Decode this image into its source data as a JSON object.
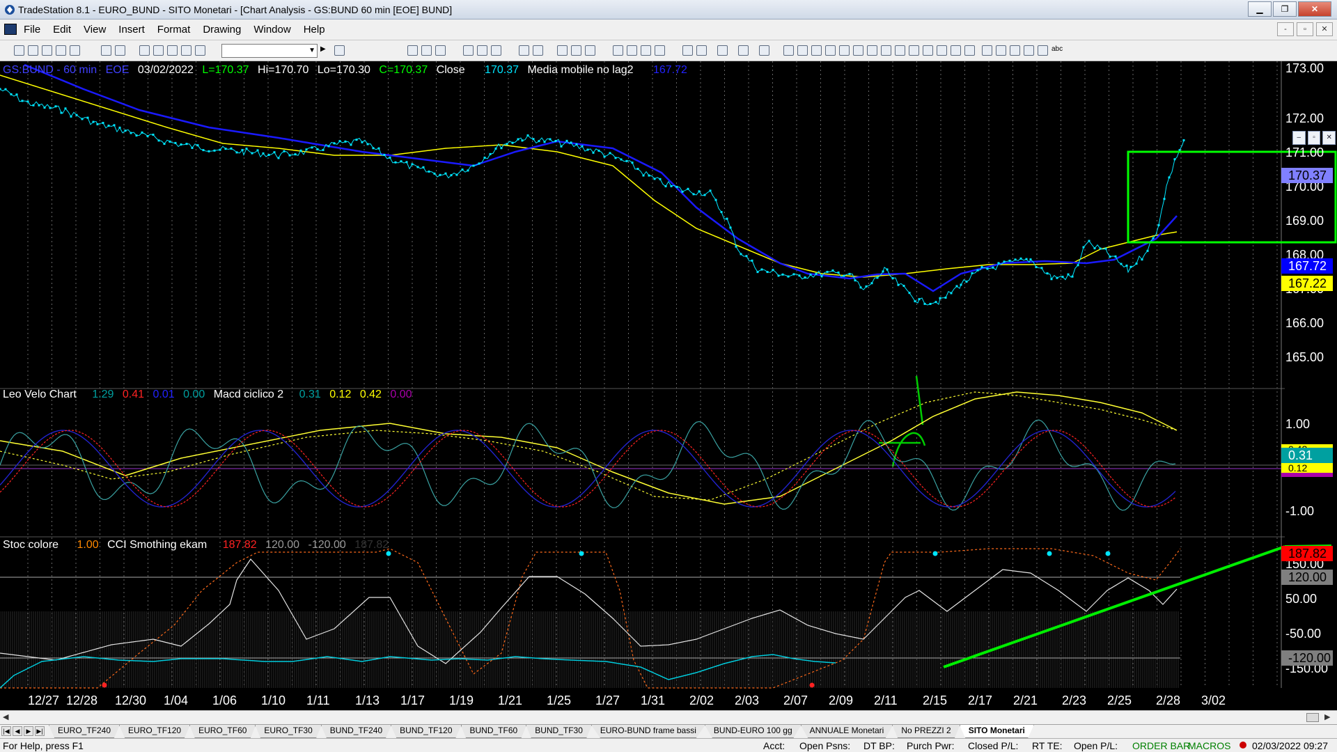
{
  "window": {
    "title": "TradeStation 8.1 - EURO_BUND - SITO Monetari - [Chart Analysis - GS:BUND  60 min  [EOE] BUND]",
    "buttons": [
      "▁",
      "❐",
      "✕"
    ]
  },
  "menubar": {
    "items": [
      "File",
      "Edit",
      "View",
      "Insert",
      "Format",
      "Drawing",
      "Window",
      "Help"
    ],
    "mdi_buttons": [
      "-",
      "▫",
      "✕"
    ]
  },
  "price_pane": {
    "header": {
      "symbol": "GS:BUND - 60 min",
      "session": "EOE",
      "date": "03/02/2022",
      "last": "L=170.37",
      "high": "Hi=170.70",
      "low": "Lo=170.30",
      "close": "C=170.37",
      "close_label": "Close",
      "close_value": "170.37",
      "indicator_name": "Media mobile no lag2",
      "indicator_value": "167.72"
    },
    "axis_labels": [
      "173.00",
      "172.00",
      "171.00",
      "170.00",
      "169.00",
      "168.00",
      "167.00",
      "166.00",
      "165.00"
    ],
    "tags": [
      {
        "text": "170.37",
        "bg": "#8080ff",
        "fg": "#000000"
      },
      {
        "text": "167.72",
        "bg": "#0000ff",
        "fg": "#ffffff"
      },
      {
        "text": "167.22",
        "bg": "#ffff00",
        "fg": "#000000"
      }
    ]
  },
  "osc_pane": {
    "header": {
      "name1": "Leo Velo Chart",
      "v1": "1.29",
      "v2": "0.41",
      "v3": "0.01",
      "v4": "0.00",
      "name2": "Macd ciclico 2",
      "v5": "0.31",
      "v6": "0.12",
      "v7": "0.42",
      "v8": "0.00"
    },
    "axis_labels": [
      "1.00",
      "-1.00"
    ],
    "tags": [
      {
        "text": "0.42",
        "bg": "#ffff00",
        "fg": "#000000"
      },
      {
        "text": "0.31",
        "bg": "#00a0a0",
        "fg": "#ffffff"
      },
      {
        "text": "0.12",
        "bg": "#ffff00",
        "fg": "#000000"
      }
    ]
  },
  "cci_pane": {
    "header": {
      "name1": "Stoc colore",
      "v1": "1.00",
      "name2": "CCI Smothing ekam",
      "v2": "187.82",
      "v3": "120.00",
      "v4": "-120.00",
      "v5": "187.82"
    },
    "axis_labels": [
      "150.00",
      "50.00",
      "-50.00",
      "-150.00"
    ],
    "tags": [
      {
        "text": "187.82",
        "bg": "#ff0000",
        "fg": "#000000"
      },
      {
        "text": "120.00",
        "bg": "#7f7f7f",
        "fg": "#000000"
      },
      {
        "text": "-120.00",
        "bg": "#7f7f7f",
        "fg": "#000000"
      }
    ]
  },
  "date_axis": [
    "12/27",
    "12/28",
    "12/30",
    "1/04",
    "1/06",
    "1/10",
    "1/11",
    "1/13",
    "1/17",
    "1/19",
    "1/21",
    "1/25",
    "1/27",
    "1/31",
    "2/02",
    "2/03",
    "2/07",
    "2/09",
    "2/11",
    "2/15",
    "2/17",
    "2/21",
    "2/23",
    "2/25",
    "2/28",
    "3/02"
  ],
  "tabs": [
    "EURO_TF240",
    "EURO_TF120",
    "EURO_TF60",
    "EURO_TF30",
    "BUND_TF240",
    "BUND_TF120",
    "BUND_TF60",
    "BUND_TF30",
    "EURO-BUND frame bassi",
    "BUND-EURO 100 gg",
    "ANNUALE Monetari",
    "No PREZZI 2",
    "SITO Monetari"
  ],
  "active_tab": "SITO Monetari",
  "statusbar": {
    "help": "For Help, press F1",
    "acct": "Acct:",
    "open_psns": "Open Psns:",
    "dt_bp": "DT BP:",
    "purch_pwr": "Purch Pwr:",
    "closed_pl": "Closed P/L:",
    "rt_te": "RT TE:",
    "open_pl": "Open P/L:",
    "order_bar": "ORDER BAR",
    "macros": "MACROS",
    "datetime": "02/03/2022 09:27"
  },
  "colors": {
    "price": "#00ffff",
    "ma_blue": "#0000ff",
    "ma_yellow": "#ffff00",
    "annotation": "#00ff00",
    "osc_red": "#ff0000",
    "cci_white": "#ffffff",
    "stoch_orange": "#ff6600"
  }
}
